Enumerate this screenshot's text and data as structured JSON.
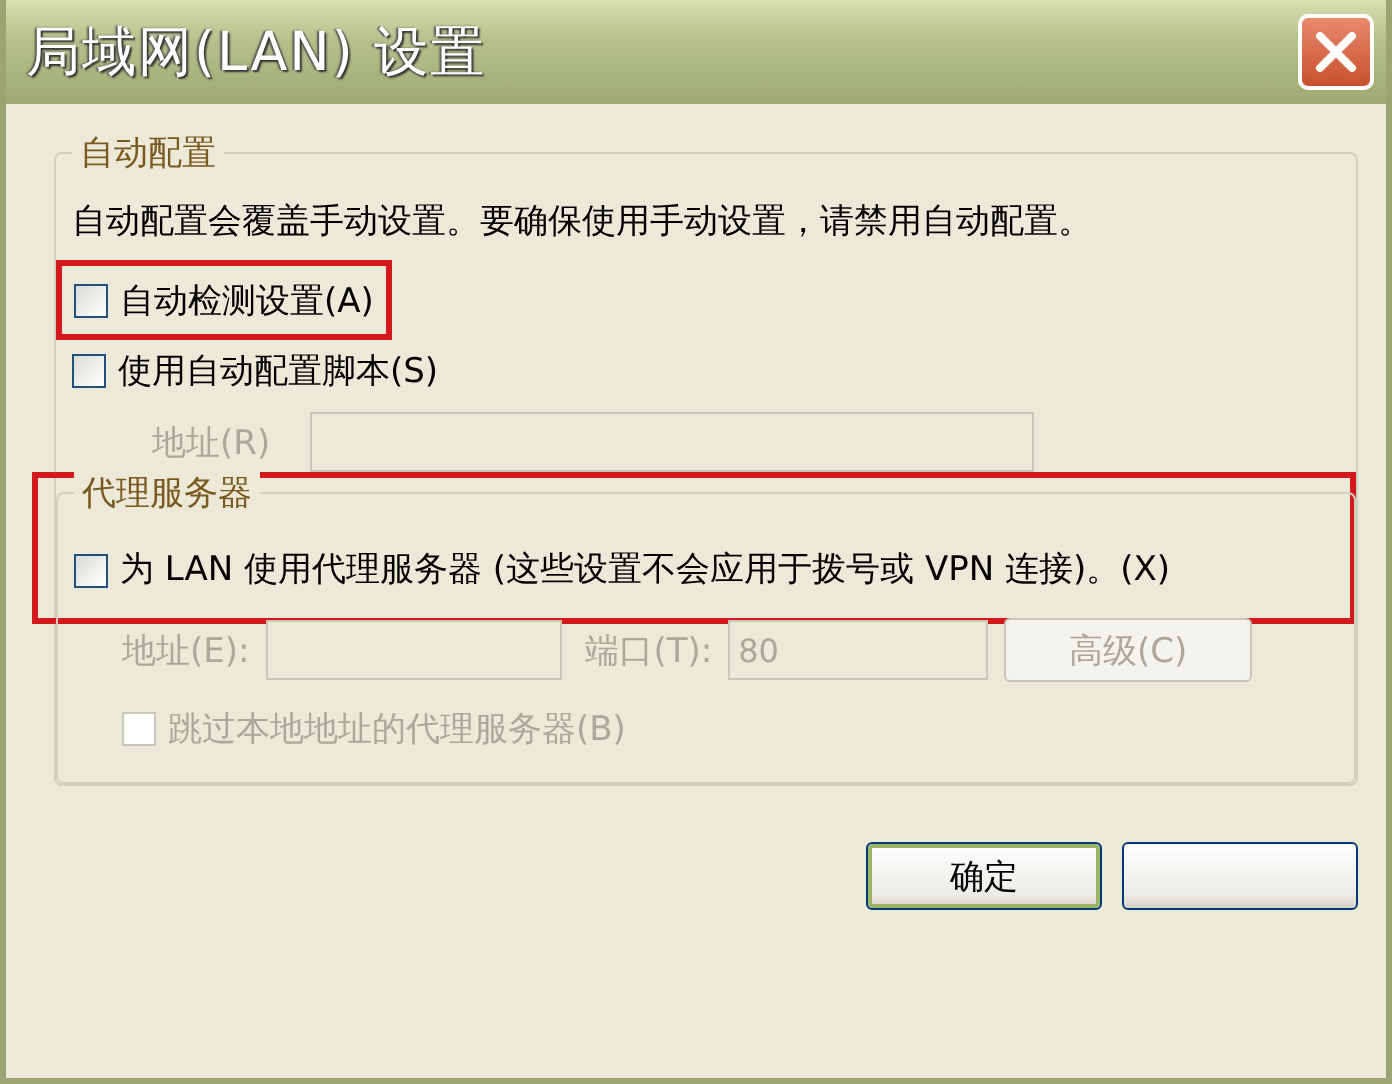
{
  "window": {
    "title": "局域网(LAN) 设置"
  },
  "auto_config": {
    "legend": "自动配置",
    "description": "自动配置会覆盖手动设置。要确保使用手动设置，请禁用自动配置。",
    "options": [
      {
        "label": "自动检测设置(A)",
        "checked": false,
        "highlighted": true
      },
      {
        "label": "使用自动配置脚本(S)",
        "checked": false,
        "highlighted": false
      }
    ],
    "address": {
      "label": "地址(R)",
      "disabled": true
    }
  },
  "proxy": {
    "legend": "代理服务器",
    "highlighted": true,
    "use_proxy": {
      "label": "为 LAN 使用代理服务器 (这些设置不会应用于拨号或 VPN 连接)。(X)",
      "checked": false
    },
    "address": {
      "label": "地址(E):",
      "disabled": true
    },
    "port": {
      "label": "端口(T):",
      "value": "80",
      "disabled": true
    },
    "advanced_button": {
      "label": "高级(C)",
      "disabled": true
    },
    "bypass": {
      "label": "跳过本地地址的代理服务器(B)",
      "checked": false,
      "disabled": true
    }
  },
  "buttons": [
    {
      "label": "确定",
      "default": true
    },
    {
      "default": false
    }
  ]
}
